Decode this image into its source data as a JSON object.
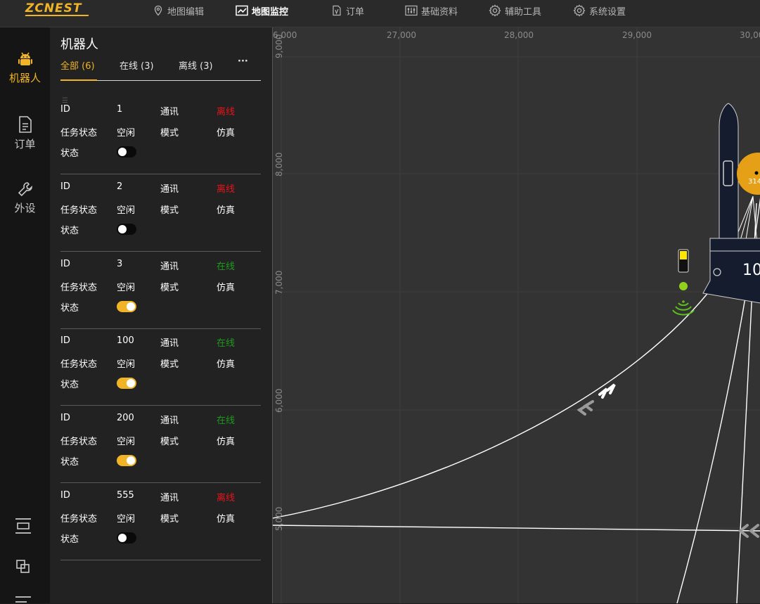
{
  "app": {
    "logo": "ZCNEST"
  },
  "nav": [
    {
      "label": "地图编辑",
      "icon": "map-pin-icon"
    },
    {
      "label": "地图监控",
      "icon": "monitor-chart-icon"
    },
    {
      "label": "订单",
      "icon": "document-icon"
    },
    {
      "label": "基础资料",
      "icon": "sliders-icon"
    },
    {
      "label": "辅助工具",
      "icon": "gear-icon"
    },
    {
      "label": "系统设置",
      "icon": "gear-icon"
    }
  ],
  "rail": {
    "items": [
      {
        "label": "机器人",
        "icon": "android-robot-icon"
      },
      {
        "label": "订单",
        "icon": "document-icon"
      },
      {
        "label": "外设",
        "icon": "wrench-icon"
      }
    ],
    "bottom_icons": [
      "layout-icon",
      "layers-icon",
      "list-icon"
    ]
  },
  "panel": {
    "title": "机器人",
    "tabs": [
      "全部 (6)",
      "在线 (3)",
      "离线 (3)"
    ],
    "more": "···",
    "labels": {
      "id": "ID",
      "comm": "通讯",
      "task_status": "任务状态",
      "mode": "模式",
      "status": "状态"
    },
    "robots": [
      {
        "id": "1",
        "comm": "离线",
        "task": "空闲",
        "mode": "仿真",
        "enabled": false
      },
      {
        "id": "2",
        "comm": "离线",
        "task": "空闲",
        "mode": "仿真",
        "enabled": false
      },
      {
        "id": "3",
        "comm": "在线",
        "task": "空闲",
        "mode": "仿真",
        "enabled": true
      },
      {
        "id": "100",
        "comm": "在线",
        "task": "空闲",
        "mode": "仿真",
        "enabled": true
      },
      {
        "id": "200",
        "comm": "在线",
        "task": "空闲",
        "mode": "仿真",
        "enabled": true
      },
      {
        "id": "555",
        "comm": "离线",
        "task": "空闲",
        "mode": "仿真",
        "enabled": false
      }
    ]
  },
  "map": {
    "x_ticks": [
      "6,000",
      "27,000",
      "28,000",
      "29,000",
      "30,00"
    ],
    "y_ticks": [
      "9,000",
      "8,000",
      "7,000",
      "6,000",
      "5,000"
    ],
    "robot_label": "10",
    "marker_label": "314"
  },
  "colors": {
    "accent": "#f0b426",
    "offline": "#e8141a",
    "online": "#1e9a1e"
  }
}
